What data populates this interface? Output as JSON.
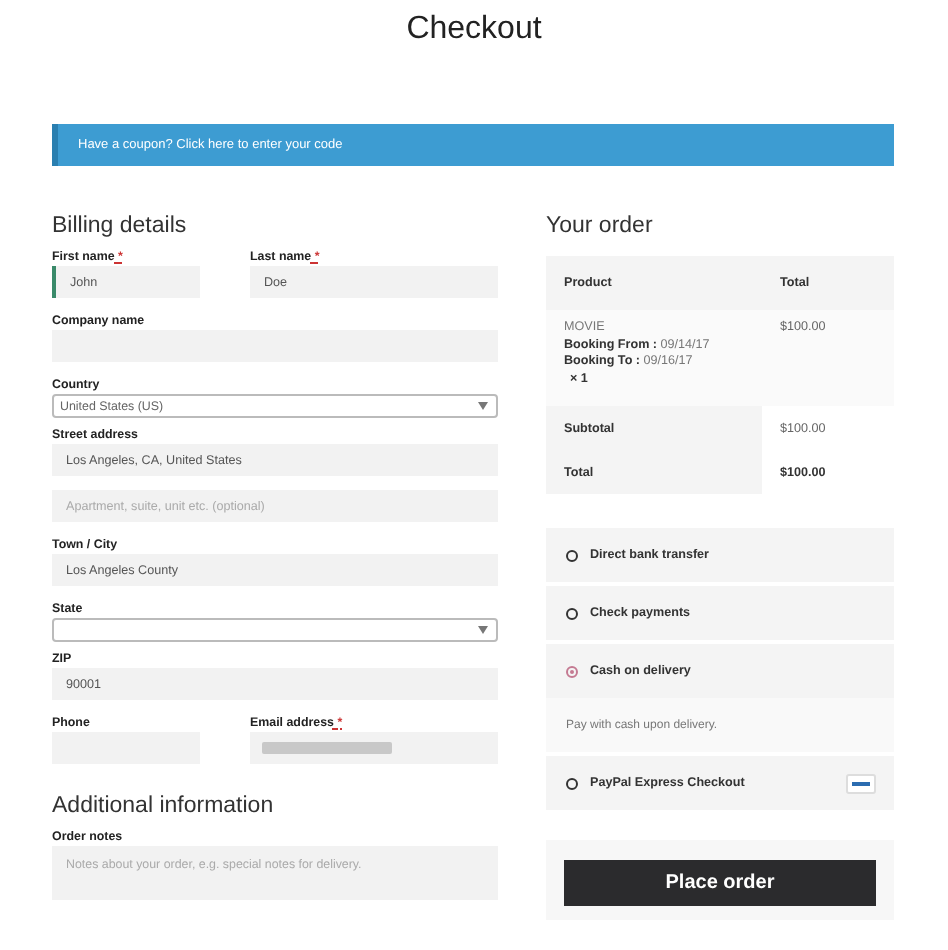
{
  "title": "Checkout",
  "coupon_notice": "Have a coupon? Click here to enter your code",
  "billing": {
    "heading": "Billing details",
    "rows": [
      [
        {
          "kind": "text",
          "label": "First name",
          "required_mark": "*",
          "value": "John",
          "focused": true
        },
        {
          "kind": "text",
          "label": "Last name",
          "required_mark": "*",
          "value": "Doe",
          "focused": false
        }
      ],
      [
        {
          "kind": "text",
          "label": "Company name",
          "focused": false
        }
      ],
      [
        {
          "kind": "select",
          "label": "Country",
          "value": "United States (US)"
        }
      ],
      [
        {
          "kind": "text",
          "label": "Street address",
          "value": "Los Angeles, CA, United States",
          "focused": false
        }
      ],
      [
        {
          "kind": "text",
          "placeholder": "Apartment, suite, unit etc. (optional)",
          "focused": false
        }
      ],
      [
        {
          "kind": "text",
          "label": "Town / City",
          "value": "Los Angeles County",
          "focused": false
        }
      ],
      [
        {
          "kind": "select",
          "label": "State"
        }
      ],
      [
        {
          "kind": "text",
          "label": "ZIP",
          "value": "90001",
          "focused": false
        }
      ],
      [
        {
          "kind": "text",
          "label": "Phone",
          "focused": false
        },
        {
          "kind": "redacted",
          "label": "Email address",
          "required_mark": "*"
        }
      ]
    ]
  },
  "additional": {
    "heading": "Additional information",
    "label": "Order notes",
    "placeholder": "Notes about your order, e.g. special notes for delivery."
  },
  "order": {
    "heading": "Your order",
    "columns": [
      "Product",
      "Total"
    ],
    "product": {
      "name": "MOVIE",
      "meta": [
        {
          "key": "Booking From :",
          "value": "09/14/17"
        },
        {
          "key": "Booking To :",
          "value": "09/16/17"
        }
      ],
      "quantity": "× 1",
      "total": "$100.00"
    },
    "subtotal": {
      "label": "Subtotal",
      "value": "$100.00"
    },
    "total": {
      "label": "Total",
      "value": "$100.00"
    }
  },
  "payment_methods": [
    {
      "label": "Direct bank transfer",
      "selected": false
    },
    {
      "label": "Check payments",
      "selected": false
    },
    {
      "label": "Cash on delivery",
      "selected": true,
      "description": "Pay with cash upon delivery."
    },
    {
      "label": "PayPal Express Checkout",
      "selected": false,
      "logo": true
    }
  ],
  "place_order": "Place order"
}
